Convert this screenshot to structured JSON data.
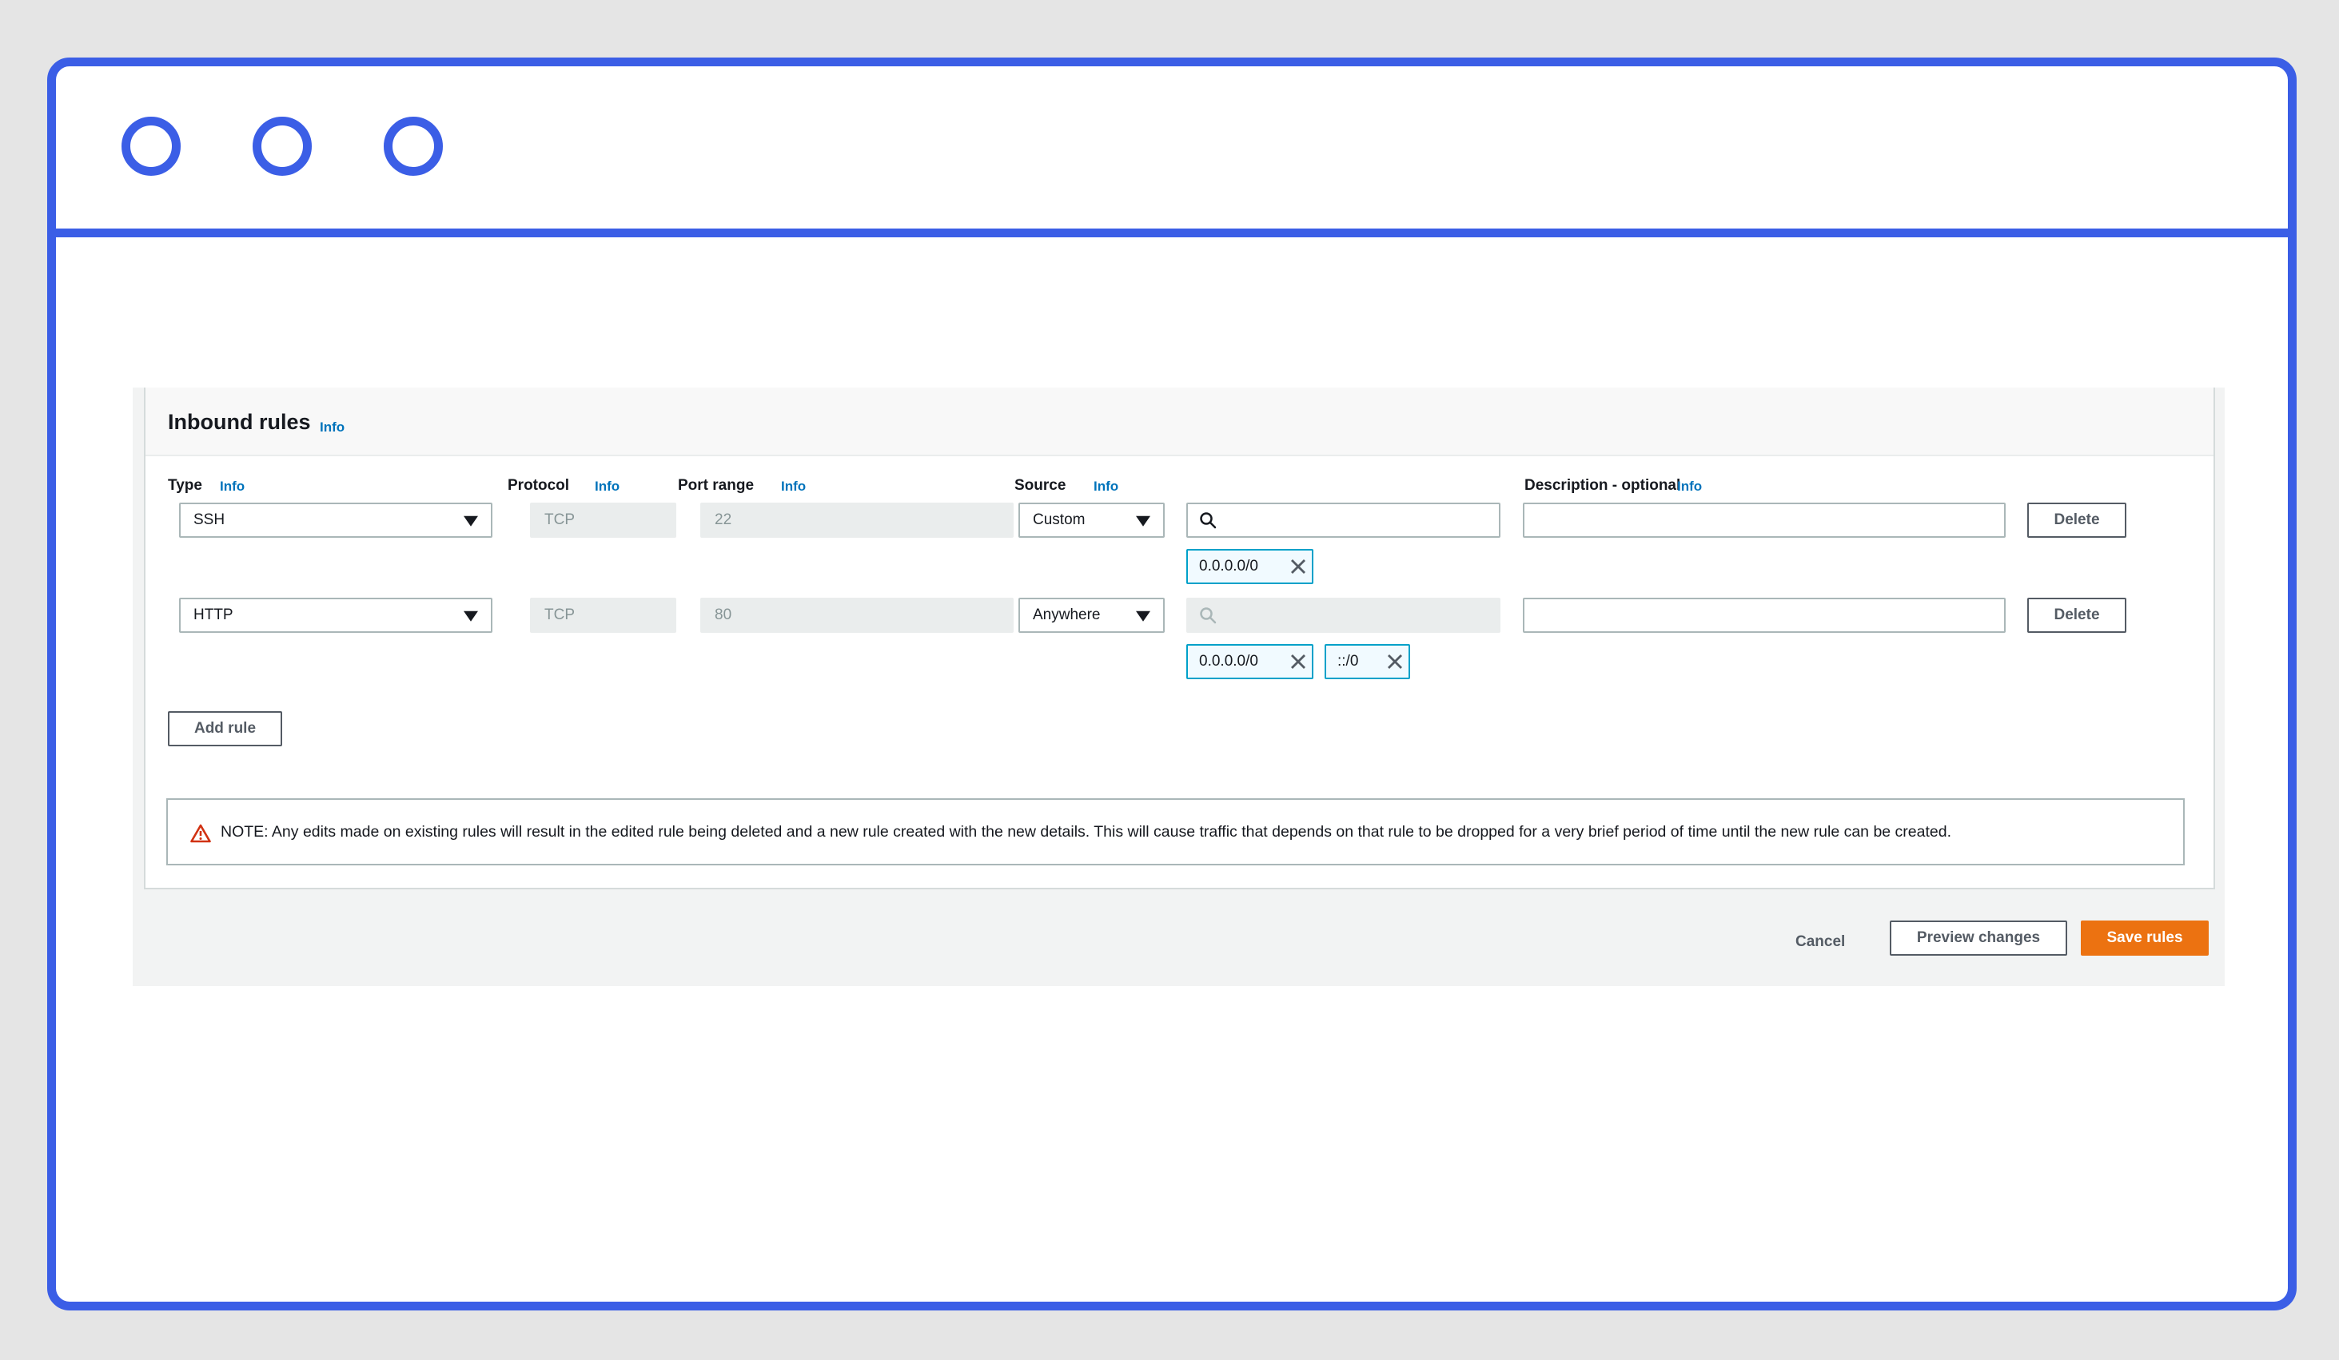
{
  "window": {
    "controls": [
      "circle",
      "circle",
      "circle"
    ]
  },
  "section": {
    "title": "Inbound rules",
    "title_info": "Info"
  },
  "columns": {
    "type": {
      "label": "Type",
      "info": "Info"
    },
    "protocol": {
      "label": "Protocol",
      "info": "Info"
    },
    "port_range": {
      "label": "Port range",
      "info": "Info"
    },
    "source": {
      "label": "Source",
      "info": "Info"
    },
    "description": {
      "label": "Description - optional",
      "info": "Info"
    }
  },
  "rules": [
    {
      "type": "SSH",
      "protocol": "TCP",
      "port_range": "22",
      "source": "Custom",
      "search_value": "",
      "cidrs": [
        "0.0.0.0/0"
      ],
      "description": "",
      "delete_label": "Delete"
    },
    {
      "type": "HTTP",
      "protocol": "TCP",
      "port_range": "80",
      "source": "Anywhere",
      "search_value": "",
      "cidrs": [
        "0.0.0.0/0",
        "::/0"
      ],
      "description": "",
      "delete_label": "Delete"
    }
  ],
  "add_rule_label": "Add rule",
  "note": "NOTE: Any edits made on existing rules will result in the edited rule being deleted and a new rule created with the new details. This will cause traffic that depends on that rule to be dropped for a very brief period of time until the new rule can be created.",
  "footer": {
    "cancel": "Cancel",
    "preview": "Preview changes",
    "save": "Save rules"
  },
  "colors": {
    "window_border": "#3b5ee6",
    "info_link": "#0073bb",
    "primary": "#ec7211",
    "token_border": "#00a1c9",
    "warning": "#d13212"
  }
}
